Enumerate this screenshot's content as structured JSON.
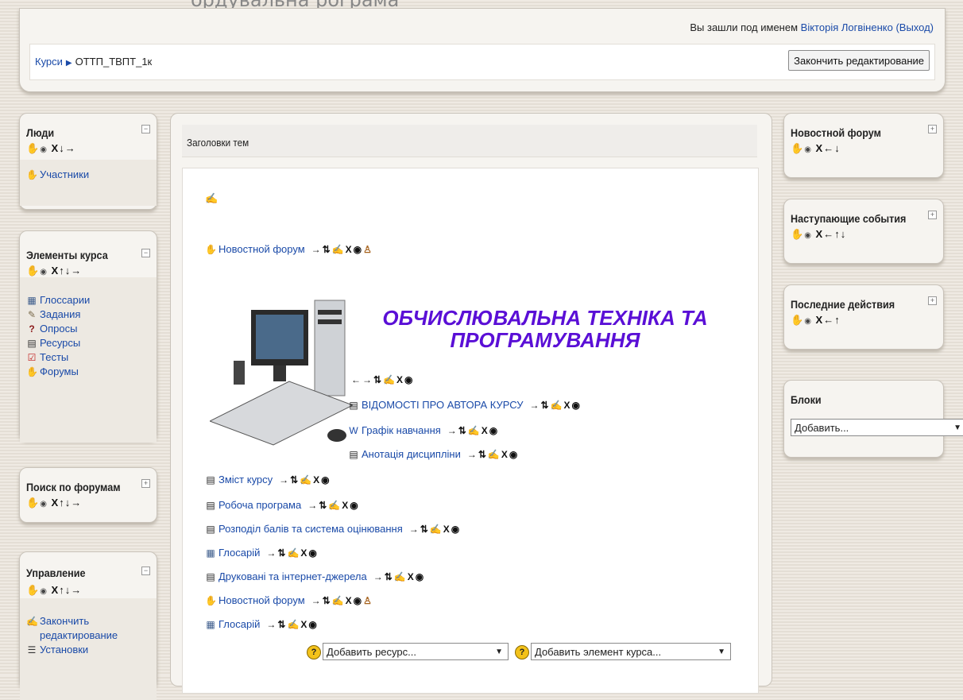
{
  "header": {
    "login_prefix": "Вы зашли под именем",
    "user_name": "Вікторія Логвіненко",
    "logout": "(Выход)",
    "breadcrumb": [
      "Курси",
      "ОТТП_ТВПТ_1к"
    ],
    "finish_editing": "Закончить редактирование"
  },
  "left_blocks": {
    "people": {
      "title": "Люди",
      "items": [
        {
          "label": "Участники",
          "icon": "people-icon"
        }
      ]
    },
    "activities": {
      "title": "Элементы курса",
      "items": [
        {
          "label": "Глоссарии",
          "icon": "glossary-icon"
        },
        {
          "label": "Задания",
          "icon": "assignment-icon"
        },
        {
          "label": "Опросы",
          "icon": "question-icon"
        },
        {
          "label": "Ресурсы",
          "icon": "resource-icon"
        },
        {
          "label": "Тесты",
          "icon": "quiz-icon"
        },
        {
          "label": "Форумы",
          "icon": "forum-icon"
        }
      ]
    },
    "search": {
      "title": "Поиск по форумам"
    },
    "admin": {
      "title": "Управление",
      "items": [
        {
          "label": "Закончить",
          "icon": "edit-icon"
        },
        {
          "label": "редактирование",
          "icon": ""
        },
        {
          "label": "Установки",
          "icon": "settings-icon"
        }
      ]
    }
  },
  "main": {
    "section_title": "Заголовки тем",
    "news_forum": "Новостной форум",
    "course_heading_line1": "ОБЧИСЛЮВАЛЬНА ТЕХНІКА ТА",
    "course_heading_line2": "ПРОГРАМУВАННЯ",
    "resources": [
      "ВІДОМОСТІ ПРО АВТОРА КУРСУ",
      "Графік навчання",
      "Анотація дисципліни",
      "Зміст курсу",
      "Робоча програма",
      "Розподіл балів та система оцінювання",
      "Глосарій",
      "Друковані та інтернет-джерела",
      "Новостной форум",
      "Глосарій"
    ],
    "add_resource": "Добавить ресурс...",
    "add_activity": "Добавить элемент курса..."
  },
  "right_blocks": {
    "news": {
      "title": "Новостной форум"
    },
    "upcoming": {
      "title": "Наступающие события"
    },
    "recent": {
      "title": "Последние действия"
    },
    "blocks": {
      "title": "Блоки",
      "add": "Добавить..."
    }
  }
}
